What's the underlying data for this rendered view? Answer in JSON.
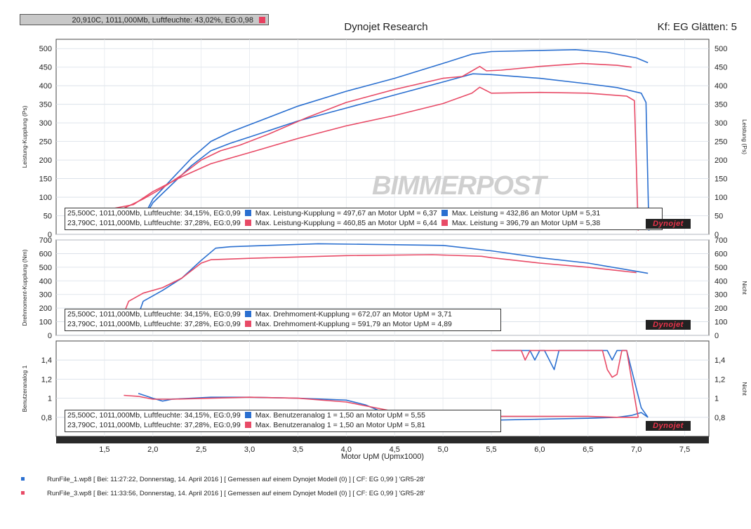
{
  "status": "20,910C, 1011,000Mb, Luftfeuchte: 43,02%, EG:0,98",
  "header": {
    "title": "Dynojet Research",
    "right": "Kf: EG Glätten: 5"
  },
  "watermark": "BIMMERPOST",
  "logo_text": "Dynojet",
  "colors": {
    "run1": "#2a6fd0",
    "run2": "#e84a66"
  },
  "chart_data": [
    {
      "type": "line",
      "ylabel_left": "Leistung-Kupplung (Ps)",
      "ylabel_right": "Leistung (Ps)",
      "xlim": [
        1.0,
        7.75
      ],
      "ylim": [
        0,
        525
      ],
      "yticks": [
        0,
        50,
        100,
        150,
        200,
        250,
        300,
        350,
        400,
        450,
        500
      ],
      "legend": [
        {
          "cond": "25,500C, 1011,000Mb, Luftfeuchte: 34,15%, EG:0,99",
          "a": "Max. Leistung-Kupplung = 497,67 an Motor UpM = 6,37",
          "b": "Max. Leistung = 432,86 an Motor UpM = 5,31"
        },
        {
          "cond": "23,790C, 1011,000Mb, Luftfeuchte: 37,28%, EG:0,99",
          "a": "Max. Leistung-Kupplung = 460,85 an Motor UpM = 6,44",
          "b": "Max. Leistung = 396,79 an Motor UpM = 5,38"
        }
      ],
      "series": [
        {
          "run": 1,
          "x": [
            1.85,
            2.0,
            2.2,
            2.4,
            2.6,
            2.8,
            3.0,
            3.5,
            4.0,
            4.5,
            5.0,
            5.3,
            5.5,
            6.0,
            6.37,
            6.7,
            7.0,
            7.12
          ],
          "y": [
            20,
            95,
            150,
            205,
            250,
            275,
            295,
            345,
            385,
            420,
            460,
            485,
            492,
            495,
            497,
            490,
            475,
            462
          ]
        },
        {
          "run": 1,
          "x": [
            1.85,
            2.0,
            2.2,
            2.4,
            2.6,
            2.8,
            3.0,
            3.5,
            4.0,
            4.5,
            5.0,
            5.31,
            5.5,
            6.0,
            6.5,
            6.8,
            7.05,
            7.1,
            7.13
          ],
          "y": [
            18,
            85,
            135,
            185,
            225,
            245,
            262,
            305,
            340,
            375,
            410,
            432,
            430,
            420,
            405,
            395,
            380,
            355,
            10
          ]
        },
        {
          "run": 2,
          "x": [
            1.7,
            1.9,
            2.1,
            2.3,
            2.5,
            2.7,
            2.9,
            3.2,
            3.6,
            4.0,
            4.5,
            5.0,
            5.2,
            5.38,
            5.45,
            5.6,
            6.0,
            6.44,
            6.8,
            6.95
          ],
          "y": [
            70,
            95,
            125,
            160,
            200,
            225,
            240,
            270,
            315,
            355,
            390,
            420,
            425,
            452,
            440,
            442,
            452,
            460,
            455,
            450
          ]
        },
        {
          "run": 2,
          "x": [
            1.6,
            1.8,
            2.0,
            2.3,
            2.6,
            2.8,
            3.0,
            3.5,
            4.0,
            4.5,
            5.0,
            5.3,
            5.38,
            5.5,
            6.0,
            6.5,
            6.9,
            6.98,
            7.02
          ],
          "y": [
            70,
            80,
            115,
            155,
            190,
            205,
            220,
            258,
            292,
            320,
            352,
            380,
            396,
            380,
            382,
            380,
            372,
            360,
            10
          ]
        }
      ]
    },
    {
      "type": "line",
      "ylabel_left": "Drehmoment-Kupplung (Nm)",
      "ylabel_right": "Nicht",
      "xlim": [
        1.0,
        7.75
      ],
      "ylim": [
        0,
        700
      ],
      "yticks": [
        0,
        100,
        200,
        300,
        400,
        500,
        600,
        700
      ],
      "legend": [
        {
          "cond": "25,500C, 1011,000Mb, Luftfeuchte: 34,15%, EG:0,99",
          "a": "Max. Drehmoment-Kupplung = 672,07 an Motor UpM = 3,71"
        },
        {
          "cond": "23,790C, 1011,000Mb, Luftfeuchte: 37,28%, EG:0,99",
          "a": "Max. Drehmoment-Kupplung = 591,79 an Motor UpM = 4,89"
        }
      ],
      "series": [
        {
          "run": 1,
          "x": [
            1.85,
            1.9,
            2.1,
            2.3,
            2.5,
            2.65,
            2.8,
            3.0,
            3.71,
            4.5,
            5.0,
            5.5,
            6.0,
            6.5,
            7.0,
            7.12
          ],
          "y": [
            150,
            250,
            330,
            420,
            550,
            640,
            650,
            655,
            672,
            665,
            660,
            620,
            570,
            530,
            470,
            455
          ]
        },
        {
          "run": 2,
          "x": [
            1.7,
            1.75,
            1.9,
            2.1,
            2.3,
            2.5,
            2.6,
            2.8,
            3.0,
            3.5,
            4.0,
            4.89,
            5.4,
            5.5,
            6.0,
            6.5,
            7.0
          ],
          "y": [
            160,
            250,
            310,
            350,
            420,
            530,
            555,
            560,
            565,
            575,
            585,
            592,
            580,
            570,
            530,
            500,
            460
          ]
        }
      ]
    },
    {
      "type": "line",
      "ylabel_left": "Benutzeranalog 1",
      "ylabel_right": "Nicht",
      "xlim": [
        1.0,
        7.75
      ],
      "ylim": [
        0.6,
        1.6
      ],
      "yticks": [
        0.8,
        1.0,
        1.2,
        1.4
      ],
      "xlabel": "Motor UpM (Upmx1000)",
      "xticks": [
        1.5,
        2.0,
        2.5,
        3.0,
        3.5,
        4.0,
        4.5,
        5.0,
        5.5,
        6.0,
        6.5,
        7.0,
        7.5
      ],
      "legend": [
        {
          "cond": "25,500C, 1011,000Mb, Luftfeuchte: 34,15%, EG:0,99",
          "a": "Max. Benutzeranalog 1 = 1,50 an Motor UpM = 5,55"
        },
        {
          "cond": "23,790C, 1011,000Mb, Luftfeuchte: 37,28%, EG:0,99",
          "a": "Max. Benutzeranalog 1 = 1,50 an Motor UpM = 5,81"
        }
      ],
      "series": [
        {
          "run": 1,
          "x": [
            1.85,
            2.0,
            2.1,
            2.2,
            2.6,
            3.0,
            3.5,
            4.0,
            4.2,
            4.5,
            5.0,
            5.5,
            6.0,
            6.5,
            6.8,
            6.95,
            7.05,
            7.12
          ],
          "y": [
            1.05,
            1.0,
            0.97,
            0.99,
            1.01,
            1.01,
            1.0,
            0.98,
            0.93,
            0.8,
            0.76,
            0.77,
            0.78,
            0.79,
            0.8,
            0.82,
            0.85,
            0.8
          ]
        },
        {
          "run": 1,
          "x": [
            5.55,
            5.8,
            5.9,
            5.95,
            6.0,
            6.05,
            6.1,
            6.15,
            6.2,
            6.3,
            6.7,
            6.75,
            6.8,
            6.85,
            6.9,
            6.95,
            7.05,
            7.12
          ],
          "y": [
            1.5,
            1.5,
            1.5,
            1.4,
            1.5,
            1.5,
            1.4,
            1.3,
            1.5,
            1.5,
            1.5,
            1.4,
            1.5,
            1.5,
            1.5,
            1.3,
            0.9,
            0.8
          ]
        },
        {
          "run": 2,
          "x": [
            1.7,
            1.85,
            2.0,
            2.2,
            2.6,
            3.0,
            3.5,
            4.0,
            4.5,
            5.0,
            5.5,
            6.0,
            6.5,
            6.8,
            6.95,
            7.02
          ],
          "y": [
            1.03,
            1.02,
            0.99,
            0.99,
            1.0,
            1.01,
            1.0,
            0.96,
            0.86,
            0.83,
            0.81,
            0.81,
            0.81,
            0.8,
            0.8,
            0.8
          ]
        },
        {
          "run": 2,
          "x": [
            5.5,
            5.81,
            5.85,
            5.9,
            5.95,
            6.0,
            6.5,
            6.65,
            6.7,
            6.75,
            6.8,
            6.85,
            6.9,
            6.95,
            7.0,
            7.02
          ],
          "y": [
            1.5,
            1.5,
            1.4,
            1.5,
            1.5,
            1.5,
            1.5,
            1.5,
            1.3,
            1.22,
            1.25,
            1.5,
            1.5,
            1.2,
            0.9,
            0.8
          ]
        }
      ]
    }
  ],
  "footer": [
    "RunFile_1.wp8 [ Bei: 11:27:22, Donnerstag, 14. April 2016 ] [ Gemessen auf einem Dynojet Modell (0) ] [ CF: EG 0,99 ] 'GR5-28'",
    "RunFile_3.wp8 [ Bei: 11:33:56, Donnerstag, 14. April 2016 ] [ Gemessen auf einem Dynojet Modell (0) ] [ CF: EG 0,99 ] 'GR5-28'"
  ]
}
